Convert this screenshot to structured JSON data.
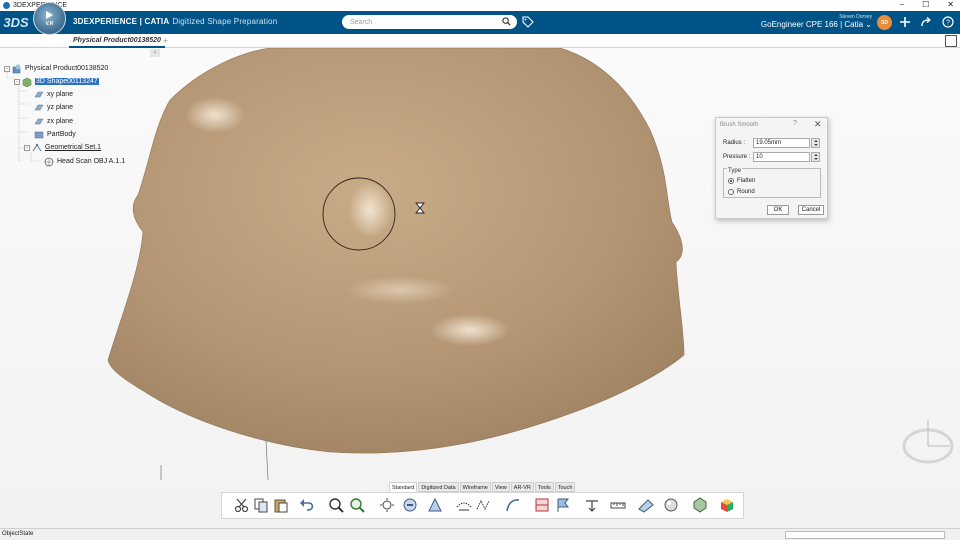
{
  "os": {
    "title": "3DEXPERIENCE",
    "min": "−",
    "max": "☐",
    "close": "✕"
  },
  "header": {
    "logo": "3DS",
    "compass_version": "V.R",
    "brand_bold": "3DEXPERIENCE | CATIA",
    "app_name": "Digitized Shape Preparation",
    "search_placeholder": "Search",
    "user_name": "Steven Dorsey",
    "tenant": "GoEngineer CPE 166 | Catia",
    "avatar_initials": "SD"
  },
  "tab_strip": {
    "active_tab": "Physical Product00138520",
    "add": "+"
  },
  "tree": {
    "collapse": "‹",
    "nodes": [
      {
        "label": "Physical Product00138520",
        "expander": "−"
      },
      {
        "label": "3D Shape00113247",
        "expander": "−"
      },
      {
        "label": "xy plane"
      },
      {
        "label": "yz plane"
      },
      {
        "label": "zx plane"
      },
      {
        "label": "PartBody"
      },
      {
        "label": "Geometrical Set.1",
        "expander": "−"
      },
      {
        "label": "Head Scan OBJ A.1.1"
      }
    ]
  },
  "dialog": {
    "title": "Brush Smooth",
    "help": "?",
    "close": "✕",
    "radius_label": "Radius :",
    "radius_value": "19.05mm",
    "pressure_label": "Pressure :",
    "pressure_value": "10",
    "type_label": "Type",
    "option_flatten": "Flatten",
    "option_round": "Round",
    "selected_type": "Flatten",
    "ok": "OK",
    "cancel": "Cancel"
  },
  "tool_tabs": [
    "Standard",
    "Digitized Data",
    "Wireframe",
    "View",
    "AR-VR",
    "Tools",
    "Touch"
  ],
  "active_tool_tab": "Standard",
  "status": {
    "text": "ObjectState"
  },
  "colors": {
    "header": "#005386",
    "mesh": "#b79a77",
    "selection": "#2a72c6"
  }
}
